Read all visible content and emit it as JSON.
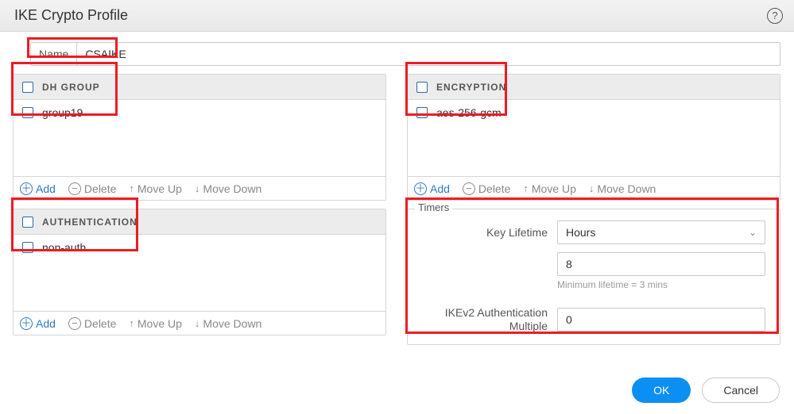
{
  "dialog": {
    "title": "IKE Crypto Profile"
  },
  "name": {
    "label": "Name",
    "value": "CSAIKE"
  },
  "columns": {
    "dh": {
      "title": "DH GROUP",
      "items": [
        "group19"
      ]
    },
    "enc": {
      "title": "ENCRYPTION",
      "items": [
        "aes-256-gcm"
      ]
    },
    "auth": {
      "title": "AUTHENTICATION",
      "items": [
        "non-auth"
      ]
    }
  },
  "toolbar": {
    "add": "Add",
    "delete": "Delete",
    "moveUp": "Move Up",
    "moveDown": "Move Down"
  },
  "timers": {
    "legend": "Timers",
    "keyLifetime": {
      "label": "Key Lifetime",
      "unit": "Hours",
      "value": "8",
      "hint": "Minimum lifetime = 3 mins"
    },
    "ikev2": {
      "label": "IKEv2 Authentication Multiple",
      "value": "0"
    }
  },
  "footer": {
    "ok": "OK",
    "cancel": "Cancel"
  }
}
